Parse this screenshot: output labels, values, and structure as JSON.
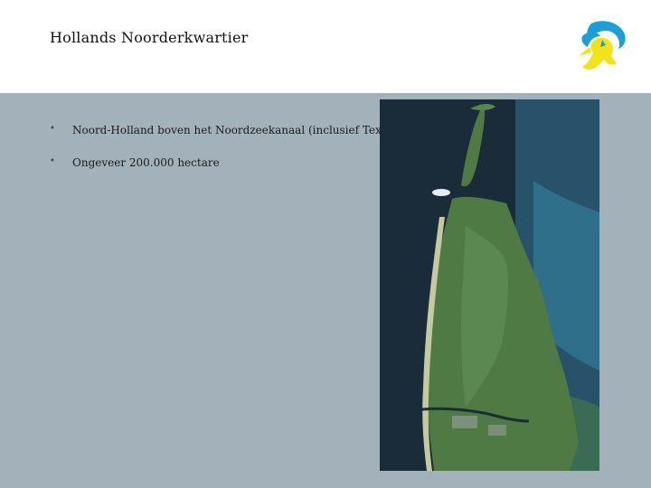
{
  "slide": {
    "title": "Hollands Noorderkwartier",
    "bullets": [
      {
        "text": "Noord-Holland boven het Noordzeekanaal (inclusief Texel)"
      },
      {
        "text": "Ongeveer 200.000 hectare"
      }
    ],
    "bullet_glyph": "•"
  },
  "logo": {
    "icon": "lion-logo-icon",
    "colors": [
      "#1a9fd6",
      "#f2e21a"
    ]
  },
  "map_image": {
    "icon": "satellite-map-north-holland",
    "colors": {
      "sea": "#1a2c3a",
      "land": "#4f7a44",
      "shallow": "#2f6f8a"
    }
  }
}
